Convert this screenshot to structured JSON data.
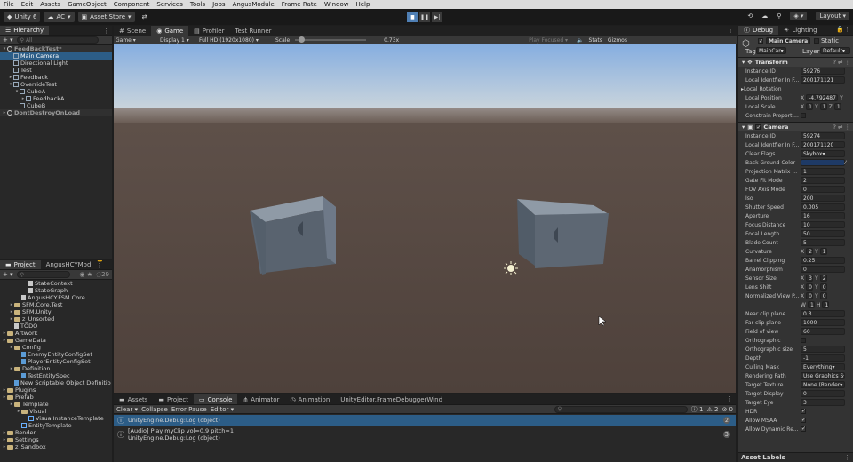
{
  "menu": [
    "File",
    "Edit",
    "Assets",
    "GameObject",
    "Component",
    "Services",
    "Tools",
    "Jobs",
    "AngusModule",
    "Frame Rate",
    "Window",
    "Help"
  ],
  "toolbar": {
    "account": "Unity 6",
    "ac": "AC",
    "asset_store": "Asset Store",
    "layers": "Layers",
    "layout": "Layout"
  },
  "hierarchy": {
    "tab": "Hierarchy",
    "search_placeholder": "All",
    "items": [
      {
        "label": "FeedBackTest*",
        "indent": 0,
        "sel": false,
        "tri": "▾"
      },
      {
        "label": "Main Camera",
        "indent": 1,
        "sel": true,
        "tri": ""
      },
      {
        "label": "Directional Light",
        "indent": 1,
        "sel": false,
        "tri": ""
      },
      {
        "label": "Test",
        "indent": 1,
        "sel": false,
        "tri": ""
      },
      {
        "label": "Feedback",
        "indent": 1,
        "sel": false,
        "tri": "▸"
      },
      {
        "label": "OverrideTest",
        "indent": 1,
        "sel": false,
        "tri": "▾"
      },
      {
        "label": "CubeA",
        "indent": 2,
        "sel": false,
        "tri": "▾"
      },
      {
        "label": "FeedbackA",
        "indent": 3,
        "sel": false,
        "tri": "▸"
      },
      {
        "label": "CubeB",
        "indent": 2,
        "sel": false,
        "tri": ""
      },
      {
        "label": "DontDestroyOnLoad",
        "indent": 0,
        "sel": false,
        "tri": "▸"
      }
    ]
  },
  "project": {
    "tabs": [
      "Project",
      "AngusHCYMod"
    ],
    "count": "29",
    "items": [
      {
        "label": "StateContext",
        "indent": 3,
        "kind": "file"
      },
      {
        "label": "StateGraph",
        "indent": 3,
        "kind": "file"
      },
      {
        "label": "AngusHCY.FSM.Core",
        "indent": 2,
        "kind": "file"
      },
      {
        "label": "SFM.Core.Test",
        "indent": 1,
        "kind": "folder"
      },
      {
        "label": "SFM.Unity",
        "indent": 1,
        "kind": "folder"
      },
      {
        "label": "z_Unsorted",
        "indent": 1,
        "kind": "folder"
      },
      {
        "label": "TODO",
        "indent": 1,
        "kind": "file"
      },
      {
        "label": "Artwork",
        "indent": 0,
        "kind": "folder"
      },
      {
        "label": "GameData",
        "indent": 0,
        "kind": "folder"
      },
      {
        "label": "Config",
        "indent": 1,
        "kind": "folder"
      },
      {
        "label": "EnemyEntityConfigSet",
        "indent": 2,
        "kind": "so"
      },
      {
        "label": "PlayerEntityConfigSet",
        "indent": 2,
        "kind": "so"
      },
      {
        "label": "Definition",
        "indent": 1,
        "kind": "folder"
      },
      {
        "label": "TestEntitySpec",
        "indent": 2,
        "kind": "so"
      },
      {
        "label": "New Scriptable Object Definitio",
        "indent": 1,
        "kind": "so"
      },
      {
        "label": "Plugins",
        "indent": 0,
        "kind": "folder"
      },
      {
        "label": "Prefab",
        "indent": 0,
        "kind": "folder"
      },
      {
        "label": "Template",
        "indent": 1,
        "kind": "folder"
      },
      {
        "label": "Visual",
        "indent": 2,
        "kind": "folder"
      },
      {
        "label": "VisualInstanceTemplate",
        "indent": 3,
        "kind": "cube"
      },
      {
        "label": "EntityTemplate",
        "indent": 2,
        "kind": "cube"
      },
      {
        "label": "Render",
        "indent": 0,
        "kind": "folder"
      },
      {
        "label": "Settings",
        "indent": 0,
        "kind": "folder"
      },
      {
        "label": "z_Sandbox",
        "indent": 0,
        "kind": "folder"
      }
    ]
  },
  "center_tabs": [
    "Scene",
    "Game",
    "Profiler",
    "Test Runner"
  ],
  "game_bar": {
    "mode": "Game",
    "display": "Display 1",
    "resolution": "Full HD (1920x1080)",
    "scale_label": "Scale",
    "scale_value": "0.73x",
    "play_focused": "Play Focused",
    "stats": "Stats",
    "gizmos": "Gizmos"
  },
  "bottom": {
    "tabs": [
      "Assets",
      "Project",
      "Console",
      "Animator",
      "Animation",
      "UnityEditor.FrameDebuggerWind"
    ],
    "toolbar": [
      "Clear",
      "Collapse",
      "Error Pause",
      "Editor"
    ],
    "counts": {
      "info": "1",
      "warn": "2",
      "error": "0"
    },
    "rows": [
      {
        "line1": "",
        "line2": "UnityEngine.Debug:Log (object)",
        "count": "2",
        "sel": true
      },
      {
        "line1": "[Audio] Play myClip vol=0.9 pitch=1",
        "line2": "UnityEngine.Debug:Log (object)",
        "count": "3",
        "sel": false
      }
    ]
  },
  "inspector": {
    "tabs": [
      "Debug",
      "Lighting"
    ],
    "object_name": "Main Camera",
    "static": "Static",
    "tag_label": "Tag",
    "tag": "MainCar",
    "layer_label": "Layer",
    "layer": "Default",
    "transform": {
      "title": "Transform",
      "rows": [
        {
          "label": "Instance ID",
          "value": "59276"
        },
        {
          "label": "Local Identfier In F...",
          "value": "200171121"
        }
      ],
      "local_rotation": "Local Rotation",
      "local_position": {
        "label": "Local Position",
        "x": "-4.792487",
        "y": ""
      },
      "local_scale": {
        "label": "Local Scale",
        "x": "1",
        "y": "1",
        "z": "1"
      },
      "constrain": "Constrain Proporti..."
    },
    "camera": {
      "title": "Camera",
      "rows": [
        {
          "label": "Instance ID",
          "value": "59274"
        },
        {
          "label": "Local Identfier In F...",
          "value": "200171120"
        },
        {
          "label": "Clear Flags",
          "value": "Skybox"
        },
        {
          "label": "Back Ground Color",
          "value": ""
        },
        {
          "label": "Projection Matrix ...",
          "value": "1"
        },
        {
          "label": "Gate Fit Mode",
          "value": "2"
        },
        {
          "label": "FOV Axis Mode",
          "value": "0"
        },
        {
          "label": "Iso",
          "value": "200"
        },
        {
          "label": "Shutter Speed",
          "value": "0.005"
        },
        {
          "label": "Aperture",
          "value": "16"
        },
        {
          "label": "Focus Distance",
          "value": "10"
        },
        {
          "label": "Focal Length",
          "value": "50"
        },
        {
          "label": "Blade Count",
          "value": "5"
        }
      ],
      "curvature": {
        "label": "Curvature",
        "x": "2",
        "y": "1"
      },
      "rows2": [
        {
          "label": "Barrel Clipping",
          "value": "0.25"
        },
        {
          "label": "Anamorphism",
          "value": "0"
        }
      ],
      "sensor": {
        "label": "Sensor Size",
        "x": "3",
        "y": "2"
      },
      "lens": {
        "label": "Lens Shift",
        "x": "0",
        "y": "0"
      },
      "viewport": {
        "label": "Normalized View P...",
        "x": "0",
        "y": "0",
        "w": "1",
        "h": "1"
      },
      "rows3": [
        {
          "label": "Near clip plane",
          "value": "0.3"
        },
        {
          "label": "Far clip plane",
          "value": "1000"
        },
        {
          "label": "Field of view",
          "value": "60"
        },
        {
          "label": "Orthographic",
          "value": ""
        },
        {
          "label": "Orthographic size",
          "value": "5"
        },
        {
          "label": "Depth",
          "value": "-1"
        },
        {
          "label": "Culling Mask",
          "value": "Everything"
        },
        {
          "label": "Rendering Path",
          "value": "Use Graphics S"
        },
        {
          "label": "Target Texture",
          "value": "None (Render"
        },
        {
          "label": "Target Display",
          "value": "0"
        },
        {
          "label": "Target Eye",
          "value": "3"
        },
        {
          "label": "HDR",
          "value": ""
        },
        {
          "label": "Allow MSAA",
          "value": ""
        },
        {
          "label": "Allow Dynamic Re...",
          "value": ""
        }
      ]
    },
    "asset_labels": "Asset Labels"
  },
  "colors": {
    "accent": "#2c5d87",
    "sky_top": "#8fb3d9",
    "ground": "#5a4c44",
    "cube": "#6f7b8a"
  }
}
